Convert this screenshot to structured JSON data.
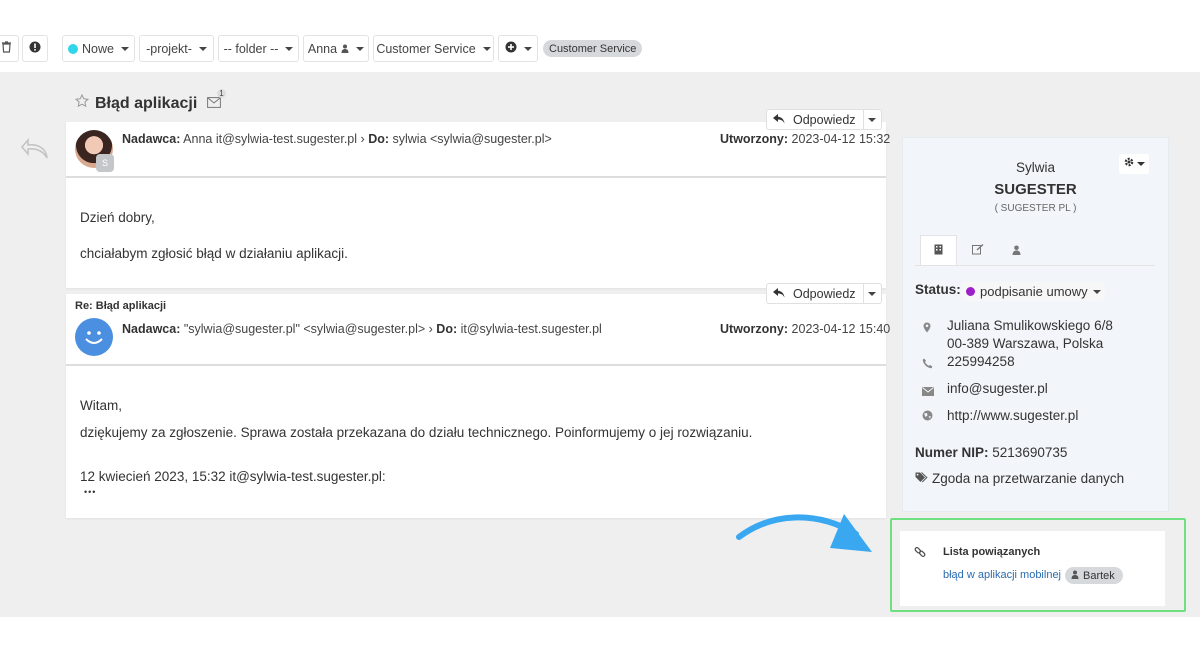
{
  "toolbar": {
    "status_label": "Nowe",
    "status_color": "#2fd5e8",
    "project_label": "-projekt-",
    "folder_label": "-- folder --",
    "user_label": "Anna",
    "department_label": "Customer Service",
    "department_pill": "Customer Service"
  },
  "ticket": {
    "subject": "Błąd aplikacji",
    "mail_count": "1"
  },
  "messages": [
    {
      "reply_label": "Odpowiedz",
      "sender_label": "Nadawca:",
      "sender_value": "Anna it@sylwia-test.sugester.pl",
      "to_label": "Do:",
      "to_value": "sylwia <sylwia@sugester.pl>",
      "created_label": "Utworzony:",
      "created_value": "2023-04-12 15:32",
      "avatar_badge": "S",
      "lines": [
        "Dzień dobry,",
        "chciałabym zgłosić błąd w działaniu aplikacji."
      ]
    },
    {
      "title": "Re: Błąd aplikacji",
      "reply_label": "Odpowiedz",
      "sender_label": "Nadawca:",
      "sender_value": "\"sylwia@sugester.pl\" <sylwia@sugester.pl>",
      "to_label": "Do:",
      "to_value": "it@sylwia-test.sugester.pl",
      "created_label": "Utworzony:",
      "created_value": "2023-04-12 15:40",
      "lines": [
        "Witam,",
        "dziękujemy za zgłoszenie. Sprawa została przekazana do działu technicznego. Poinformujemy o jej rozwiązaniu.",
        "12 kwiecień 2023, 15:32 it@sylwia-test.sugester.pl:",
        "•••"
      ]
    }
  ],
  "contact": {
    "first_name": "Sylwia",
    "last_name": "SUGESTER",
    "company": "( SUGESTER PL )",
    "status_label": "Status:",
    "status_value": "podpisanie umowy",
    "status_color": "#9c1fc7",
    "address_line1": "Juliana Smulikowskiego 6/8",
    "address_line2": "00-389 Warszawa, Polska",
    "phone": "225994258",
    "email": "info@sugester.pl",
    "website": "http://www.sugester.pl",
    "nip_label": "Numer NIP:",
    "nip_value": "5213690735",
    "consent": "Zgoda na przetwarzanie danych"
  },
  "related": {
    "title": "Lista powiązanych",
    "item_link": "błąd w aplikacji mobilnej",
    "item_user": "Bartek"
  },
  "colors": {
    "arrow": "#3aa8f0",
    "highlight": "#6fe07f",
    "link": "#2a6cb0"
  }
}
